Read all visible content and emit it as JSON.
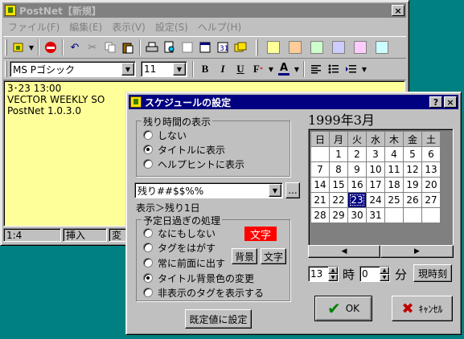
{
  "main_window": {
    "title": "PostNet【新規】",
    "menu": [
      "ファイル(F)",
      "編集(E)",
      "表示(V)",
      "設定(S)",
      "ヘルプ(H)"
    ],
    "font_name": "MS Pゴシック",
    "font_size": "11",
    "format_buttons": [
      "B",
      "I",
      "U"
    ],
    "text_lines": [
      "3･23 13:00",
      "VECTOR WEEKLY  SO",
      "PostNet 1.0.3.0"
    ],
    "status": [
      "1:4",
      "挿入",
      "変"
    ],
    "swatches": [
      "#ffff99",
      "#ffcc99",
      "#ccffcc",
      "#ccccff",
      "#ffccff",
      "#ccffff"
    ]
  },
  "dialog": {
    "title": "スケジュールの設定",
    "remaining_group": {
      "title": "残り時間の表示",
      "options": [
        {
          "label": "しない",
          "selected": false
        },
        {
          "label": "タイトルに表示",
          "selected": true
        },
        {
          "label": "ヘルプヒントに表示",
          "selected": false
        }
      ]
    },
    "format_combo": "残り##$$%%",
    "format_browse": "...",
    "preview": "表示＞残り1日",
    "overdue_group": {
      "title": "予定日過ぎの処理",
      "options": [
        {
          "label": "なにもしない",
          "selected": false
        },
        {
          "label": "タグをはがす",
          "selected": false
        },
        {
          "label": "常に前面に出す",
          "selected": false
        },
        {
          "label": "タイトル背景色の変更",
          "selected": true
        },
        {
          "label": "非表示のタグを表示する",
          "selected": false
        }
      ],
      "sample_text": "文字",
      "bg_button": "背景",
      "text_button": "文字"
    },
    "default_button": "既定値に設定",
    "calendar": {
      "title": "1999年3月",
      "weekdays": [
        "日",
        "月",
        "火",
        "水",
        "木",
        "金",
        "土"
      ],
      "weeks": [
        [
          "",
          "1",
          "2",
          "3",
          "4",
          "5",
          "6"
        ],
        [
          "7",
          "8",
          "9",
          "10",
          "11",
          "12",
          "13"
        ],
        [
          "14",
          "15",
          "16",
          "17",
          "18",
          "19",
          "20"
        ],
        [
          "21",
          "22",
          "23",
          "24",
          "25",
          "26",
          "27"
        ],
        [
          "28",
          "29",
          "30",
          "31",
          "",
          "",
          ""
        ]
      ],
      "selected": "23"
    },
    "hour": "13",
    "hour_unit": "時",
    "minute": "0",
    "minute_unit": "分",
    "now_button": "現時刻",
    "ok_label": "OK",
    "cancel_label": "ｷｬﾝｾﾙ",
    "help_button": "?",
    "close_button": "×"
  },
  "colors": {
    "desktop": "#008080",
    "memo_bg": "#ffff99",
    "sample_bg": "#ff0000",
    "selected_day": "#000080"
  }
}
